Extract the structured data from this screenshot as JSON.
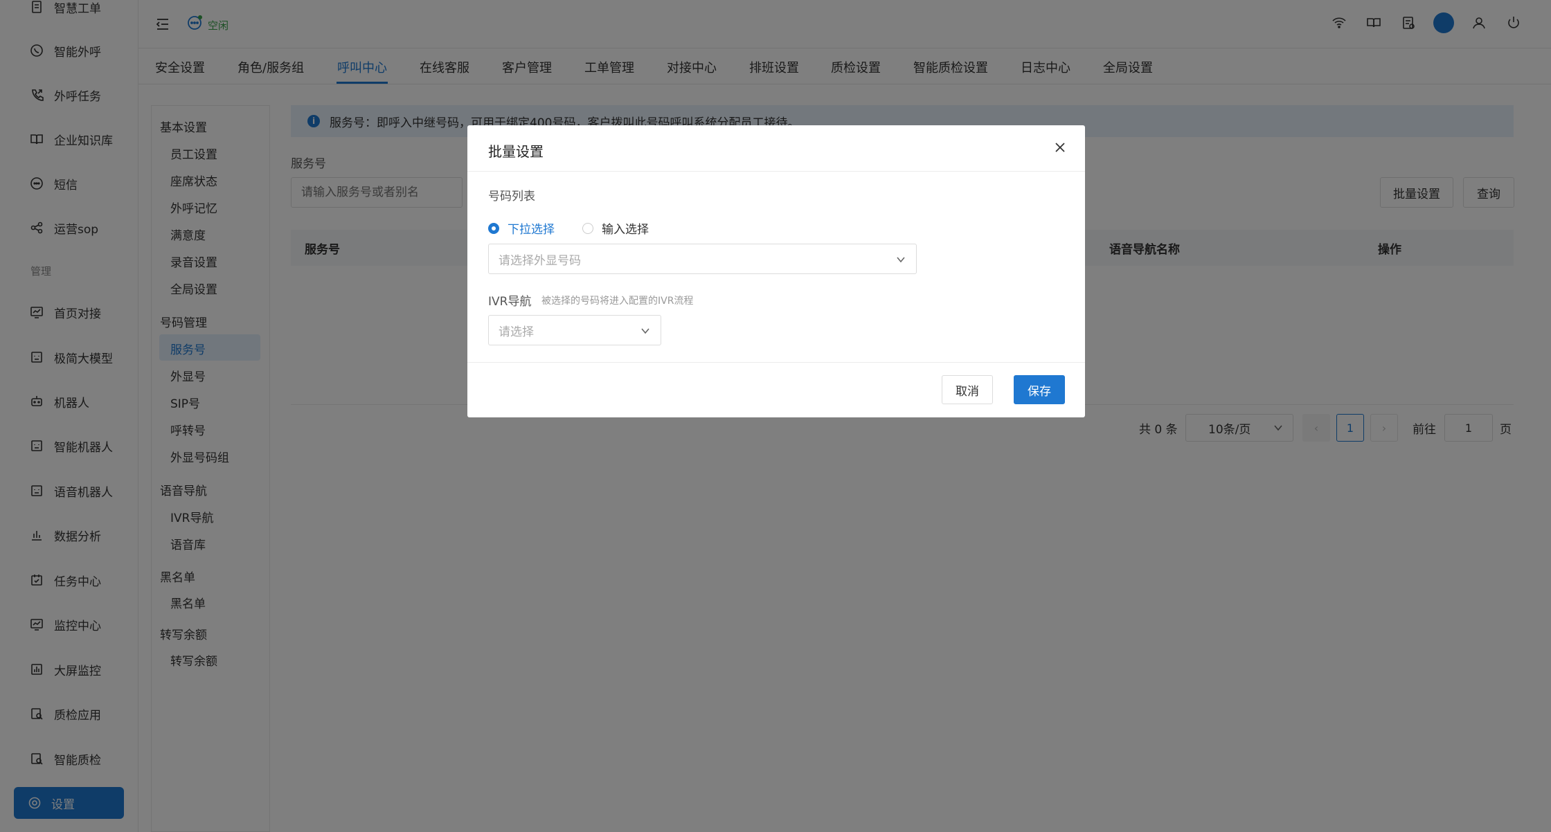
{
  "sidebar": {
    "items": [
      {
        "label": "智慧工单",
        "icon": "document-icon"
      },
      {
        "label": "智能外呼",
        "icon": "whatsapp-phone-icon"
      },
      {
        "label": "外呼任务",
        "icon": "phone-outgoing-icon"
      },
      {
        "label": "企业知识库",
        "icon": "book-icon"
      },
      {
        "label": "短信",
        "icon": "sms-icon"
      },
      {
        "label": "运营sop",
        "icon": "share-nodes-icon"
      },
      {
        "label": "首页对接",
        "icon": "chart-screen-icon"
      },
      {
        "label": "极简大模型",
        "icon": "robot-face-icon"
      },
      {
        "label": "机器人",
        "icon": "robot-icon"
      },
      {
        "label": "智能机器人",
        "icon": "robot-face-icon"
      },
      {
        "label": "语音机器人",
        "icon": "robot-face-icon"
      },
      {
        "label": "数据分析",
        "icon": "bar-chart-icon"
      },
      {
        "label": "任务中心",
        "icon": "calendar-check-icon"
      },
      {
        "label": "监控中心",
        "icon": "monitor-chart-icon"
      },
      {
        "label": "大屏监控",
        "icon": "bar-chart-box-icon"
      },
      {
        "label": "质检应用",
        "icon": "inspect-icon"
      },
      {
        "label": "智能质检",
        "icon": "inspect-icon"
      }
    ],
    "section_manage": "管理",
    "active_label": "设置"
  },
  "header": {
    "status_text": "空闲"
  },
  "tabs": [
    "安全设置",
    "角色/服务组",
    "呼叫中心",
    "在线客服",
    "客户管理",
    "工单管理",
    "对接中心",
    "排班设置",
    "质检设置",
    "智能质检设置",
    "日志中心",
    "全局设置"
  ],
  "subnav": {
    "groups": [
      {
        "title": "基本设置",
        "items": [
          "员工设置",
          "座席状态",
          "外呼记忆",
          "满意度",
          "录音设置",
          "全局设置"
        ]
      },
      {
        "title": "号码管理",
        "items": [
          "服务号",
          "外显号",
          "SIP号",
          "呼转号",
          "外显号码组"
        ]
      },
      {
        "title": "语音导航",
        "items": [
          "IVR导航",
          "语音库"
        ]
      },
      {
        "title": "黑名单",
        "items": [
          "黑名单"
        ]
      },
      {
        "title": "转写余额",
        "items": [
          "转写余额"
        ]
      }
    ]
  },
  "content": {
    "info_text": "服务号：即呼入中继号码，可用于绑定400号码，客户拨叫此号码呼叫系统分配员工接待。",
    "field_label": "服务号",
    "search_placeholder": "请输入服务号或者别名",
    "batch_button": "批量设置",
    "query_button": "查询",
    "table_headers": [
      "服务号",
      "语音导航名称",
      "操作"
    ],
    "pager": {
      "total": "共 0 条",
      "page_size": "10条/页",
      "current_page": "1",
      "goto_label": "前往",
      "goto_value": "1",
      "page_suffix": "页"
    }
  },
  "modal": {
    "title": "批量设置",
    "number_list_label": "号码列表",
    "radio_dropdown": "下拉选择",
    "radio_input": "输入选择",
    "number_select_placeholder": "请选择外显号码",
    "ivr_label": "IVR导航",
    "ivr_hint": "被选择的号码将进入配置的IVR流程",
    "ivr_select_placeholder": "请选择",
    "cancel_label": "取消",
    "save_label": "保存"
  },
  "colors": {
    "accent": "#1f78d1",
    "status_green": "#3aa14a",
    "info_bg": "#e6f0fb"
  }
}
